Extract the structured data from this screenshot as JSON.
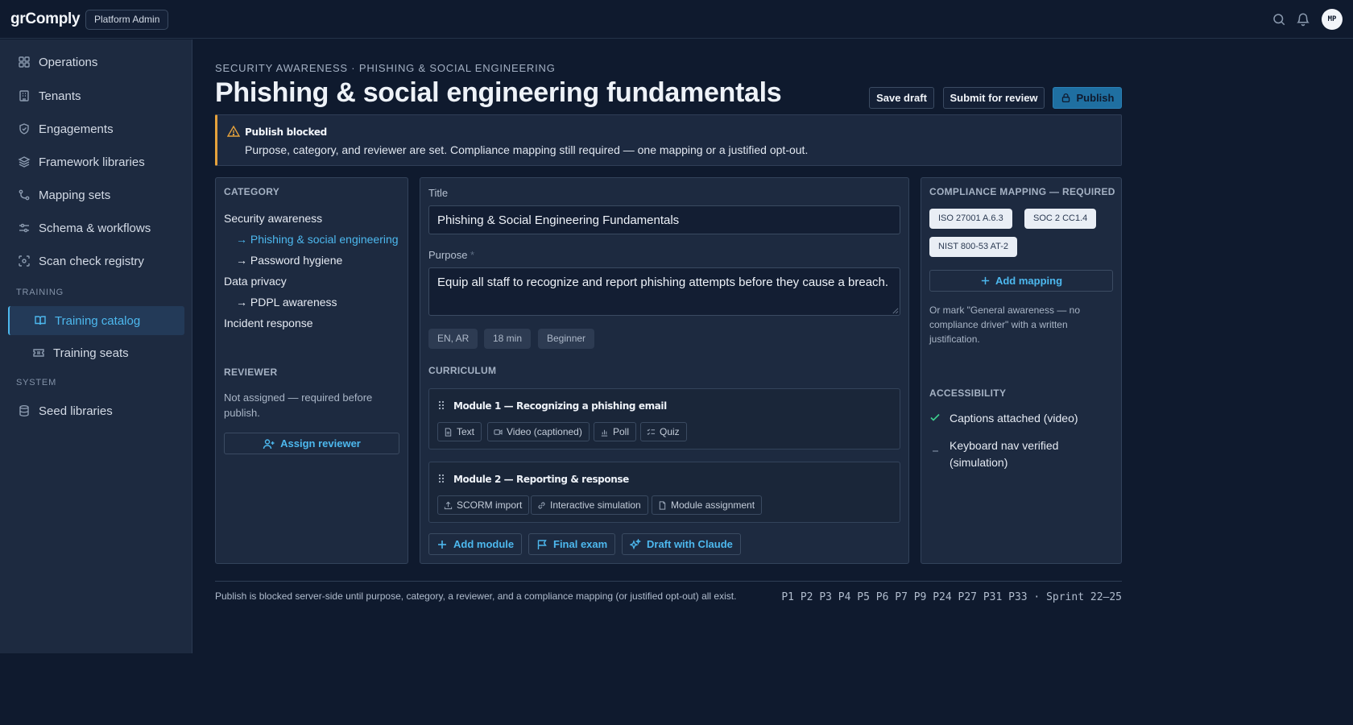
{
  "app": {
    "name": "grComply",
    "role": "Platform Admin",
    "avatar_initials": "MP"
  },
  "sidebar": {
    "items": [
      {
        "label": "Operations",
        "icon": "dashboard-icon"
      },
      {
        "label": "Tenants",
        "icon": "building-icon"
      },
      {
        "label": "Engagements",
        "icon": "shield-icon"
      },
      {
        "label": "Framework libraries",
        "icon": "layers-icon"
      },
      {
        "label": "Mapping sets",
        "icon": "git-branch-icon"
      },
      {
        "label": "Schema & workflows",
        "icon": "sliders-icon"
      },
      {
        "label": "Scan check registry",
        "icon": "scan-icon"
      }
    ],
    "sections": {
      "training": "TRAINING",
      "system": "SYSTEM"
    },
    "training_items": [
      {
        "label": "Training catalog",
        "icon": "book-icon",
        "active": true
      },
      {
        "label": "Training seats",
        "icon": "ticket-icon"
      }
    ],
    "system_items": [
      {
        "label": "Seed libraries",
        "icon": "database-icon"
      }
    ]
  },
  "header": {
    "breadcrumb": "SECURITY AWARENESS · PHISHING & SOCIAL ENGINEERING",
    "title": "Phishing & social engineering fundamentals",
    "save_draft": "Save draft",
    "submit_review": "Submit for review",
    "publish": "Publish"
  },
  "alert": {
    "title": "Publish blocked",
    "body": "Purpose, category, and reviewer are set. Compliance mapping still required — one mapping or a justified opt-out."
  },
  "category_panel": {
    "heading": "CATEGORY",
    "tree": {
      "security_awareness": "Security awareness",
      "phishing": "→ Phishing & social engineering",
      "password": "→ Password hygiene",
      "data_privacy": "Data privacy",
      "pdpl": "→ PDPL awareness",
      "incident": "Incident response"
    },
    "reviewer_heading": "REVIEWER",
    "reviewer_note": "Not assigned — required before publish.",
    "assign_button": "Assign reviewer"
  },
  "form": {
    "title_label": "Title",
    "title_value": "Phishing & Social Engineering Fundamentals",
    "purpose_label": "Purpose",
    "purpose_required": "*",
    "purpose_value": "Equip all staff to recognize and report phishing attempts before they cause a breach.",
    "tags": [
      "EN, AR",
      "18 min",
      "Beginner"
    ],
    "curriculum_heading": "CURRICULUM",
    "modules": [
      {
        "title": "Module 1 — Recognizing a phishing email",
        "chips": [
          "Text",
          "Video (captioned)",
          "Poll",
          "Quiz"
        ]
      },
      {
        "title": "Module 2 — Reporting & response",
        "chips": [
          "SCORM import",
          "Interactive simulation",
          "Module assignment"
        ]
      }
    ],
    "add_module": "Add module",
    "final_exam": "Final exam",
    "draft_claude": "Draft with Claude"
  },
  "compliance": {
    "heading": "COMPLIANCE MAPPING — REQUIRED",
    "mappings": [
      "ISO 27001 A.6.3",
      "SOC 2 CC1.4",
      "NIST 800-53 AT-2"
    ],
    "add_mapping": "Add mapping",
    "optout_note": "Or mark \"General awareness — no compliance driver\" with a written justification.",
    "accessibility_heading": "ACCESSIBILITY",
    "accessibility": [
      {
        "label": "Captions attached (video)",
        "status": "done"
      },
      {
        "label": "Keyboard nav verified (simulation)",
        "status": "pending"
      }
    ]
  },
  "footer": {
    "note": "Publish is blocked server-side until purpose, category, a reviewer, and a compliance mapping (or justified opt-out) all exist.",
    "sprint": "P1 P2 P3 P4 P5 P6 P7 P9 P24 P27 P31 P33 · Sprint 22–25"
  },
  "colors": {
    "accent": "#4db8ee",
    "warning": "#e6a23c",
    "success": "#3ecf8e",
    "background": "#0f1a2e",
    "panel": "#1d2a40"
  }
}
